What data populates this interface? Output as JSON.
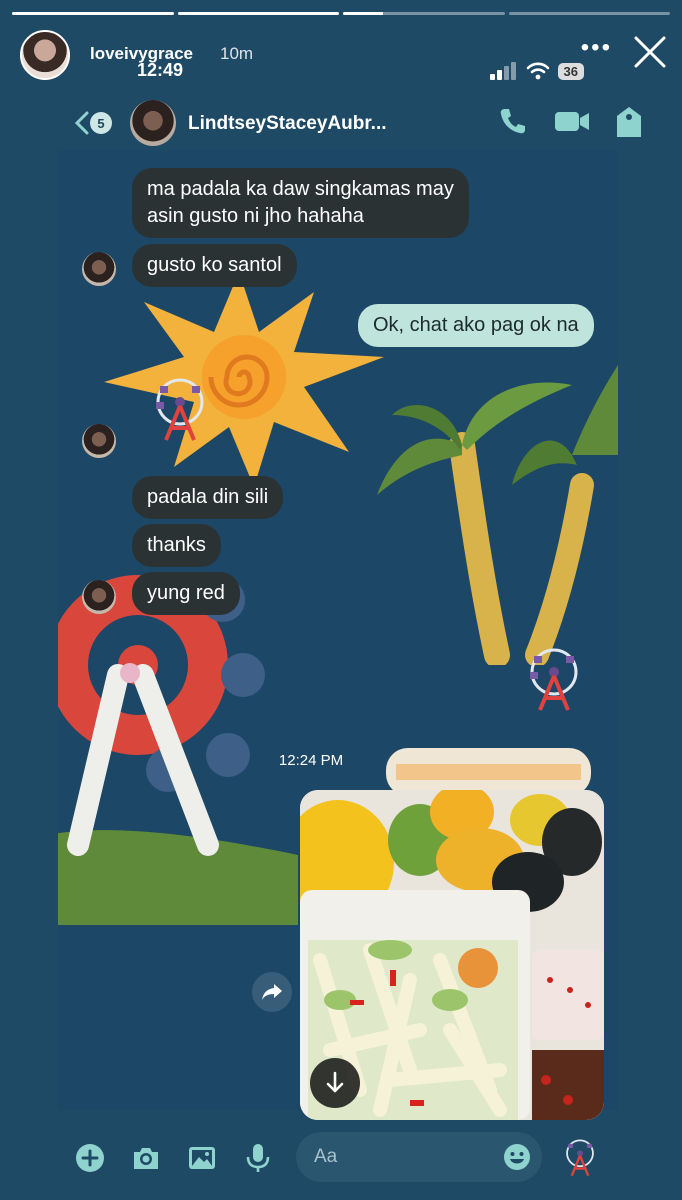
{
  "story": {
    "progress": [
      1,
      1,
      0.25,
      0
    ],
    "username": "loveivygrace",
    "posted_ago": "10m",
    "clock": "12:49",
    "battery": "36"
  },
  "chat": {
    "back_count": "5",
    "contact_name": "LindtseyStaceyAubr...",
    "timestamp": "12:24 PM",
    "composer_placeholder": "Aa",
    "messages": [
      {
        "dir": "in",
        "line1": "ma padala ka daw singkamas may",
        "line2": "asin gusto ni jho hahaha"
      },
      {
        "dir": "in",
        "text": "gusto ko santol"
      },
      {
        "dir": "out",
        "text": "Ok, chat ako pag ok na"
      },
      {
        "dir": "in",
        "text": "padala din sili"
      },
      {
        "dir": "in",
        "text": "thanks"
      },
      {
        "dir": "in",
        "text": "yung red"
      }
    ]
  },
  "colors": {
    "background": "#1f4a66",
    "incoming_bubble": "#2b3234",
    "outgoing_bubble": "#bfe4dc",
    "icon_accent": "#8fd3cf"
  }
}
